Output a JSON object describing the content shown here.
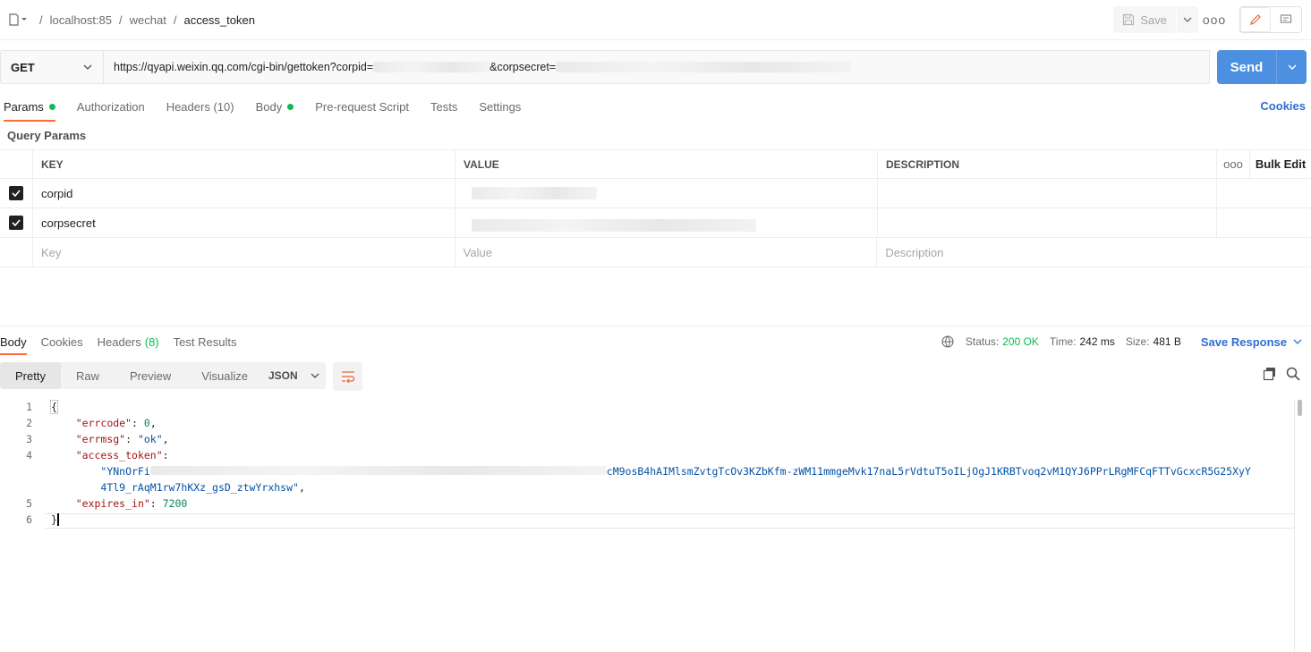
{
  "breadcrumb": {
    "items": [
      "localhost:85",
      "wechat",
      "access_token"
    ]
  },
  "header": {
    "save_label": "Save",
    "more": "ooo"
  },
  "request": {
    "method": "GET",
    "url_prefix": "https://qyapi.weixin.qq.com/cgi-bin/gettoken?corpid=",
    "url_mid": "&corpsecret=",
    "send_label": "Send"
  },
  "tabs": [
    {
      "label": "Params",
      "dot": true
    },
    {
      "label": "Authorization"
    },
    {
      "label": "Headers",
      "count": "(10)"
    },
    {
      "label": "Body",
      "dot": true
    },
    {
      "label": "Pre-request Script"
    },
    {
      "label": "Tests"
    },
    {
      "label": "Settings"
    }
  ],
  "cookies_label": "Cookies",
  "query_params_title": "Query Params",
  "params_table": {
    "headers": [
      "KEY",
      "VALUE",
      "DESCRIPTION"
    ],
    "more": "ooo",
    "bulk_edit": "Bulk Edit",
    "rows": [
      {
        "checked": true,
        "key": "corpid"
      },
      {
        "checked": true,
        "key": "corpsecret"
      }
    ],
    "placeholders": {
      "key": "Key",
      "value": "Value",
      "description": "Description"
    }
  },
  "response": {
    "tabs": [
      "Body",
      "Cookies",
      "Headers",
      "Test Results"
    ],
    "headers_count": "(8)",
    "status_label": "Status:",
    "status": "200 OK",
    "time_label": "Time:",
    "time": "242 ms",
    "size_label": "Size:",
    "size": "481 B",
    "save_response": "Save Response",
    "view_modes": [
      "Pretty",
      "Raw",
      "Preview",
      "Visualize"
    ],
    "format": "JSON"
  },
  "code": {
    "line_numbers": [
      "1",
      "2",
      "3",
      "4",
      "5",
      "6"
    ],
    "open_brace": "{",
    "close_brace": "}",
    "errcode_key": "\"errcode\"",
    "errcode_val": "0",
    "errmsg_key": "\"errmsg\"",
    "errmsg_val": "\"ok\"",
    "token_key": "\"access_token\"",
    "token_start": "\"YNnOrFi",
    "token_tail1": "cM9osB4hAIMlsmZvtgTcOv3KZbKfm-zWM11mmgeMvk17naL5rVdtuT5oILjOgJ1KRBTvoq2vM1QYJ6PPrLRgMFCqFTTvGcxcR5G25XyY",
    "token_tail2": "4Tl9_rAqM1rw7hKXz_gsD_ztwYrxhsw\"",
    "expires_key": "\"expires_in\"",
    "expires_val": "7200"
  }
}
